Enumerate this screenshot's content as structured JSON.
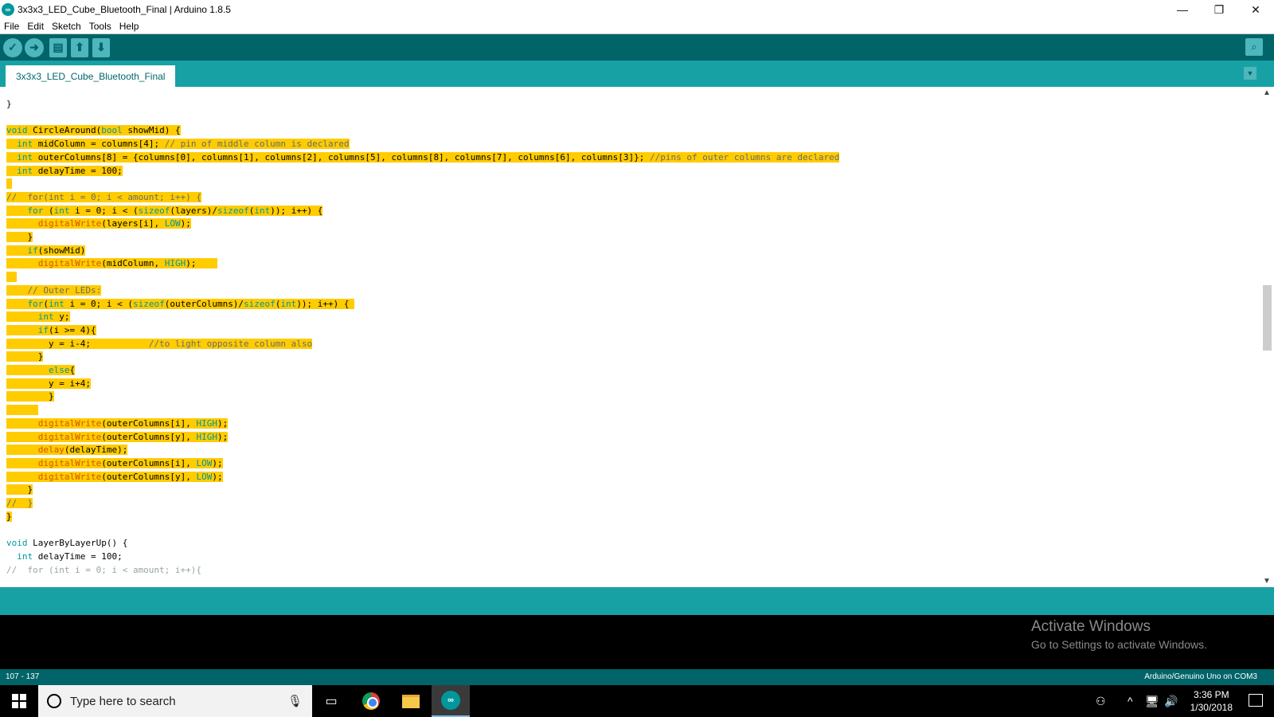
{
  "window": {
    "title": "3x3x3_LED_Cube_Bluetooth_Final | Arduino 1.8.5",
    "minimize": "—",
    "restore": "❐",
    "close": "✕"
  },
  "menu": [
    "File",
    "Edit",
    "Sketch",
    "Tools",
    "Help"
  ],
  "toolbar": {
    "verify_icon": "check-icon",
    "upload_icon": "arrow-right-icon",
    "new_icon": "document-icon",
    "open_icon": "arrow-up-icon",
    "save_icon": "arrow-down-icon",
    "serial_monitor_icon": "magnifier-icon"
  },
  "tabs": {
    "active": "3x3x3_LED_Cube_Bluetooth_Final"
  },
  "code": [
    {
      "t": "}",
      "hl": false
    },
    {
      "t": "",
      "hl": false
    },
    {
      "t": "void CircleAround(bool showMid) {",
      "hl": true
    },
    {
      "t": "  int midColumn = columns[4]; // pin of middle column is declared",
      "hl": true
    },
    {
      "t": "  int outerColumns[8] = {columns[0], columns[1], columns[2], columns[5], columns[8], columns[7], columns[6], columns[3]}; //pins of outer columns are declared",
      "hl": true
    },
    {
      "t": "  int delayTime = 100;",
      "hl": true
    },
    {
      "t": "",
      "hl": true
    },
    {
      "t": "//  for(int i = 0; i < amount; i++) {",
      "hl": true
    },
    {
      "t": "    for (int i = 0; i < (sizeof(layers)/sizeof(int)); i++) {",
      "hl": true
    },
    {
      "t": "      digitalWrite(layers[i], LOW);",
      "hl": true
    },
    {
      "t": "    }",
      "hl": true
    },
    {
      "t": "    if(showMid)",
      "hl": true
    },
    {
      "t": "      digitalWrite(midColumn, HIGH);    ",
      "hl": true
    },
    {
      "t": "  ",
      "hl": true
    },
    {
      "t": "    // Outer LEDs:",
      "hl": true
    },
    {
      "t": "    for(int i = 0; i < (sizeof(outerColumns)/sizeof(int)); i++) { ",
      "hl": true
    },
    {
      "t": "      int y;",
      "hl": true
    },
    {
      "t": "      if(i >= 4){",
      "hl": true
    },
    {
      "t": "        y = i-4;           //to light opposite column also",
      "hl": true
    },
    {
      "t": "      }",
      "hl": true
    },
    {
      "t": "        else{",
      "hl": true
    },
    {
      "t": "        y = i+4;",
      "hl": true
    },
    {
      "t": "        }",
      "hl": true
    },
    {
      "t": "      ",
      "hl": true
    },
    {
      "t": "      digitalWrite(outerColumns[i], HIGH);",
      "hl": true
    },
    {
      "t": "      digitalWrite(outerColumns[y], HIGH);",
      "hl": true
    },
    {
      "t": "      delay(delayTime);",
      "hl": true
    },
    {
      "t": "      digitalWrite(outerColumns[i], LOW);",
      "hl": true
    },
    {
      "t": "      digitalWrite(outerColumns[y], LOW);",
      "hl": true
    },
    {
      "t": "    }",
      "hl": true
    },
    {
      "t": "//  }",
      "hl": true
    },
    {
      "t": "}",
      "hl": true
    },
    {
      "t": "",
      "hl": false
    },
    {
      "t": "void LayerByLayerUp() {",
      "hl": false
    },
    {
      "t": "  int delayTime = 100;",
      "hl": false
    },
    {
      "t": "//  for (int i = 0; i < amount; i++){",
      "hl": false
    }
  ],
  "watermark": {
    "title": "Activate Windows",
    "subtitle": "Go to Settings to activate Windows."
  },
  "status": {
    "line_range": "107 - 137",
    "board": "Arduino/Genuino Uno on COM3"
  },
  "taskbar": {
    "search_placeholder": "Type here to search",
    "time": "3:36 PM",
    "date": "1/30/2018"
  },
  "colors": {
    "toolbar": "#006468",
    "tabbar": "#17a1a5",
    "highlight": "#ffcc00",
    "keyword": "#00979c",
    "function": "#d35400"
  }
}
